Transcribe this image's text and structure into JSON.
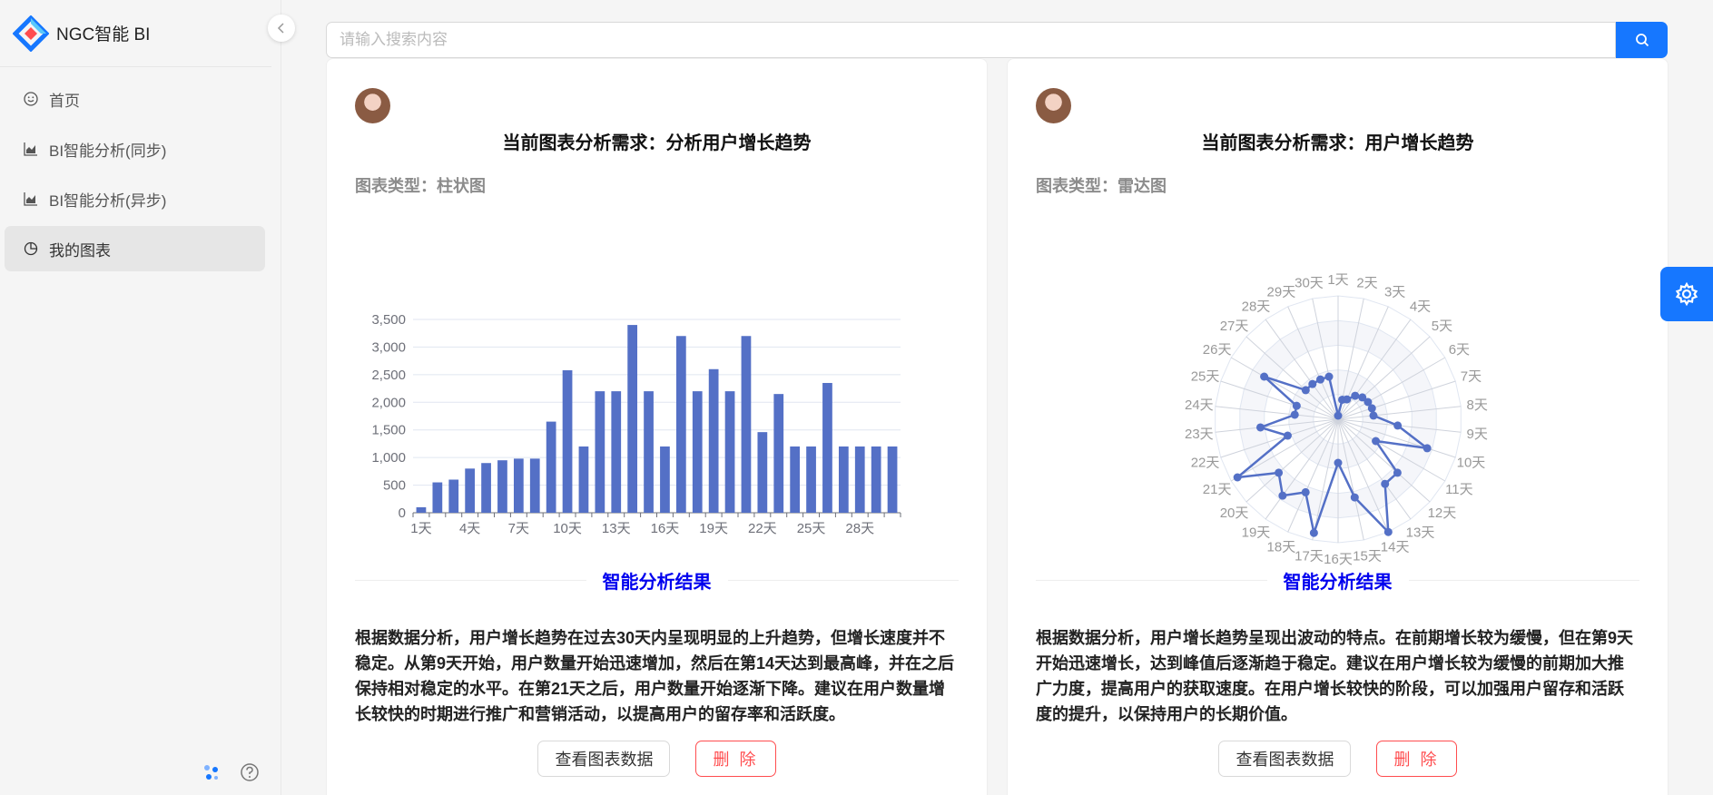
{
  "app": {
    "title": "NGC智能 BI"
  },
  "menu": {
    "items": [
      {
        "label": "首页",
        "icon": "smile-icon"
      },
      {
        "label": "BI智能分析(同步)",
        "icon": "area-chart-icon"
      },
      {
        "label": "BI智能分析(异步)",
        "icon": "area-chart-icon"
      },
      {
        "label": "我的图表",
        "icon": "pie-chart-icon",
        "active": true
      }
    ]
  },
  "search": {
    "placeholder": "请输入搜索内容",
    "value": ""
  },
  "cards": [
    {
      "title": "当前图表分析需求：分析用户增长趋势",
      "chart_type_label": "图表类型：",
      "chart_type": "柱状图",
      "result_title": "智能分析结果",
      "analysis": "根据数据分析，用户增长趋势在过去30天内呈现明显的上升趋势，但增长速度并不稳定。从第9天开始，用户数量开始迅速增加，然后在第14天达到最高峰，并在之后保持相对稳定的水平。在第21天之后，用户数量开始逐渐下降。建议在用户数量增长较快的时期进行推广和营销活动，以提高用户的留存率和活跃度。",
      "view_button": "查看图表数据",
      "delete_button": "删 除"
    },
    {
      "title": "当前图表分析需求：用户增长趋势",
      "chart_type_label": "图表类型：",
      "chart_type": "雷达图",
      "result_title": "智能分析结果",
      "analysis": "根据数据分析，用户增长趋势呈现出波动的特点。在前期增长较为缓慢，但在第9天开始迅速增长，达到峰值后逐渐趋于稳定。建议在用户增长较为缓慢的前期加大推广力度，提高用户的获取速度。在用户增长较快的阶段，可以加强用户留存和活跃度的提升，以保持用户的长期价值。",
      "view_button": "查看图表数据",
      "delete_button": "删 除"
    }
  ],
  "chart_data": [
    {
      "type": "bar",
      "categories": [
        "1天",
        "2天",
        "3天",
        "4天",
        "5天",
        "6天",
        "7天",
        "8天",
        "9天",
        "10天",
        "11天",
        "12天",
        "13天",
        "14天",
        "15天",
        "16天",
        "17天",
        "18天",
        "19天",
        "20天",
        "21天",
        "22天",
        "23天",
        "24天",
        "25天",
        "26天",
        "27天",
        "28天",
        "29天",
        "30天"
      ],
      "x_tick_labels": [
        "1天",
        "4天",
        "7天",
        "10天",
        "13天",
        "16天",
        "19天",
        "22天",
        "25天",
        "28天"
      ],
      "values": [
        100,
        550,
        600,
        800,
        900,
        950,
        980,
        980,
        1650,
        2580,
        1200,
        2200,
        2200,
        3400,
        2200,
        1200,
        3200,
        2200,
        2600,
        2200,
        3200,
        1460,
        2150,
        1200,
        1200,
        2350,
        1200,
        1200,
        1200,
        1200
      ],
      "y_ticks": [
        "0",
        "500",
        "1,000",
        "1,500",
        "2,000",
        "2,500",
        "3,000",
        "3,500"
      ],
      "ylim": [
        0,
        3500
      ],
      "color": "#5470c6",
      "grid": true
    },
    {
      "type": "radar",
      "categories": [
        "1天",
        "2天",
        "3天",
        "4天",
        "5天",
        "6天",
        "7天",
        "8天",
        "9天",
        "10天",
        "11天",
        "12天",
        "13天",
        "14天",
        "15天",
        "16天",
        "17天",
        "18天",
        "19天",
        "20天",
        "21天",
        "22天",
        "23天",
        "24天",
        "25天",
        "26天",
        "27天",
        "28天",
        "29天",
        "30天"
      ],
      "values": [
        100,
        550,
        600,
        800,
        900,
        950,
        980,
        980,
        1650,
        2580,
        1200,
        2200,
        2200,
        3400,
        2200,
        1200,
        3200,
        2200,
        2600,
        2200,
        3200,
        1460,
        2150,
        1200,
        1200,
        2350,
        1200,
        1200,
        1200,
        1200
      ],
      "max": 3400,
      "color": "#5470c6",
      "shape": "polygon"
    }
  ],
  "colors": {
    "primary": "#1677ff",
    "danger": "#ff4d4f",
    "result_title": "#0000ee",
    "series": "#5470c6"
  }
}
